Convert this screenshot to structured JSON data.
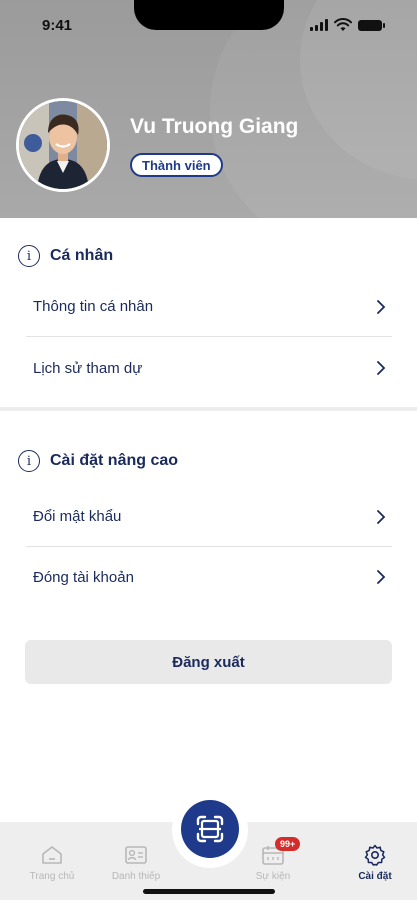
{
  "status_bar": {
    "time": "9:41"
  },
  "profile": {
    "name": "Vu Truong Giang",
    "badge": "Thành viên"
  },
  "sections": [
    {
      "title": "Cá nhân",
      "items": [
        "Thông tin cá nhân",
        "Lịch sử tham dự"
      ]
    },
    {
      "title": "Cài đặt nâng cao",
      "items": [
        "Đổi mật khẩu",
        "Đóng tài khoản"
      ]
    }
  ],
  "logout_label": "Đăng xuất",
  "tabs": [
    {
      "label": "Trang chủ",
      "icon": "home-icon"
    },
    {
      "label": "Danh thiếp",
      "icon": "id-card-icon"
    },
    {
      "label": "Sự kiện",
      "icon": "calendar-icon",
      "badge": "99+"
    },
    {
      "label": "Cài đặt",
      "icon": "gear-icon",
      "active": true
    }
  ],
  "center_action": {
    "icon": "scan-icon"
  },
  "colors": {
    "primary": "#1f3a8a",
    "header_bg": "#a3a3a3",
    "badge": "#d42b2b"
  }
}
